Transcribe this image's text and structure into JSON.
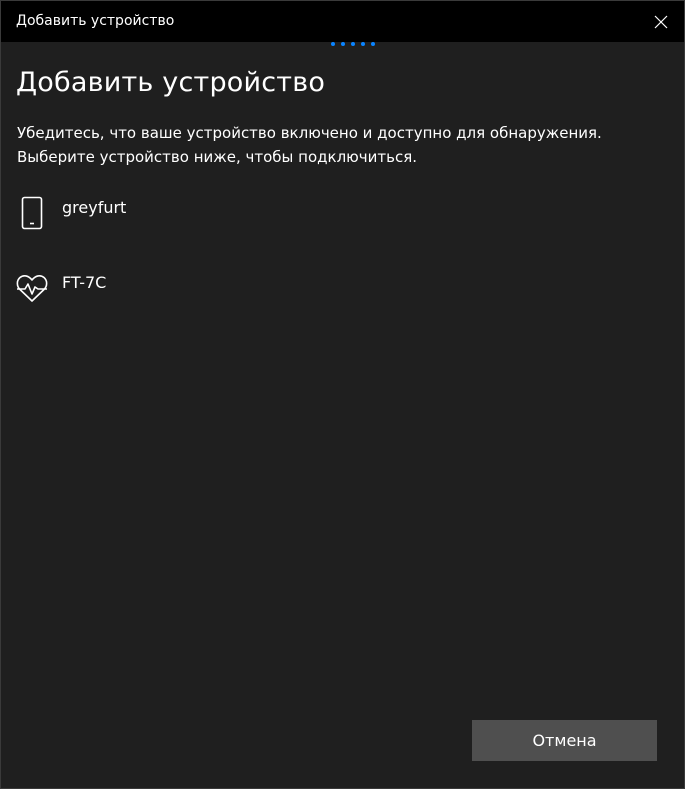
{
  "window": {
    "title": "Добавить устройство"
  },
  "main": {
    "heading": "Добавить устройство",
    "description_line1": "Убедитесь, что ваше устройство включено и доступно для обнаружения.",
    "description_line2": "Выберите устройство ниже, чтобы подключиться."
  },
  "devices": [
    {
      "name": "greyfurt",
      "icon": "phone-icon"
    },
    {
      "name": "FT-7C",
      "icon": "heart-rate-icon"
    }
  ],
  "footer": {
    "cancel_label": "Отмена"
  },
  "colors": {
    "background": "#1f1f1f",
    "titlebar": "#000000",
    "accent": "#0a84ff",
    "button": "#4f4f4f",
    "text": "#ffffff"
  }
}
